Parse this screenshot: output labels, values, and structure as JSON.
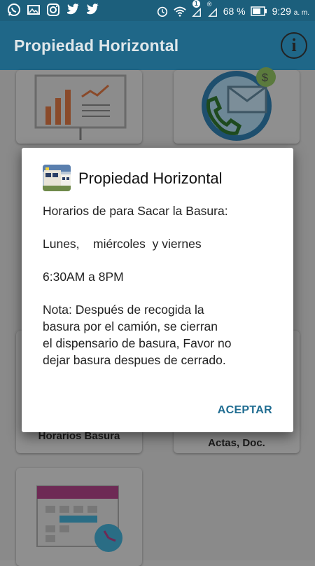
{
  "status_bar": {
    "battery": "68 %",
    "time": "9:29",
    "time_suffix": "a. m.",
    "notif_badge": "1"
  },
  "app_bar": {
    "title": "Propiedad Horizontal",
    "info_symbol": "i"
  },
  "tiles": [
    {
      "label": "",
      "icon": "presentation-chart-icon"
    },
    {
      "label": "",
      "icon": "phone-contact-icon"
    },
    {
      "label": "Horarios Basura",
      "icon": "trash-schedule-icon"
    },
    {
      "label": "Actas, Doc.",
      "icon": "documents-icon"
    },
    {
      "label": "",
      "icon": "calendar-clock-icon"
    }
  ],
  "dialog": {
    "title": "Propiedad Horizontal",
    "icon": "building-photo-icon",
    "lines": [
      "Horarios de para Sacar la Basura:",
      "Lunes,    miércoles  y viernes",
      "6:30AM a 8PM",
      "Nota: Después de recogida la\nbasura por el camión, se cierran\nel dispensario de basura, Favor no\ndejar basura despues de cerrado."
    ],
    "button": "ACEPTAR"
  },
  "colors": {
    "app_bar": "#1f6788",
    "accent": "#1f6c91"
  }
}
